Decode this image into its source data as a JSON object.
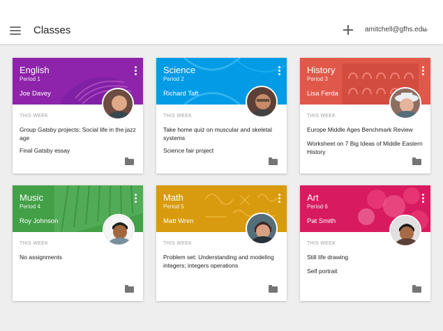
{
  "header": {
    "title": "Classes",
    "account": "amitchell@gfhs.edu"
  },
  "week_label": "THIS WEEK",
  "classes": [
    {
      "name": "English",
      "period": "Period 1",
      "teacher": "Joe Davey",
      "color": "#8e24aa",
      "tasks": [
        "Group Gatsby projects: Social life in the jazz age",
        "Final Gatsby essay"
      ]
    },
    {
      "name": "Science",
      "period": "Period 2",
      "teacher": "Richard Taft",
      "color": "#039be5",
      "tasks": [
        "Take home quiz on muscular and skeletal systems",
        "Science fair project"
      ]
    },
    {
      "name": "History",
      "period": "Period 3",
      "teacher": "Lisa Ferda",
      "color": "#e0584a",
      "tasks": [
        "Europe Middle Ages Benchmark Review",
        "Worksheet on 7 Big Ideas of Middle Eastern History"
      ]
    },
    {
      "name": "Music",
      "period": "Period 4",
      "teacher": "Roy Johnson",
      "color": "#43a047",
      "tasks": [
        "No assignments"
      ]
    },
    {
      "name": "Math",
      "period": "Period 5",
      "teacher": "Matt Wren",
      "color": "#d89b0f",
      "tasks": [
        "Problem set: Understanding and modeling integers; integers operations"
      ]
    },
    {
      "name": "Art",
      "period": "Period 6",
      "teacher": "Pat Smith",
      "color": "#d81b60",
      "tasks": [
        "Still life drawing",
        "Self portrait"
      ]
    }
  ]
}
